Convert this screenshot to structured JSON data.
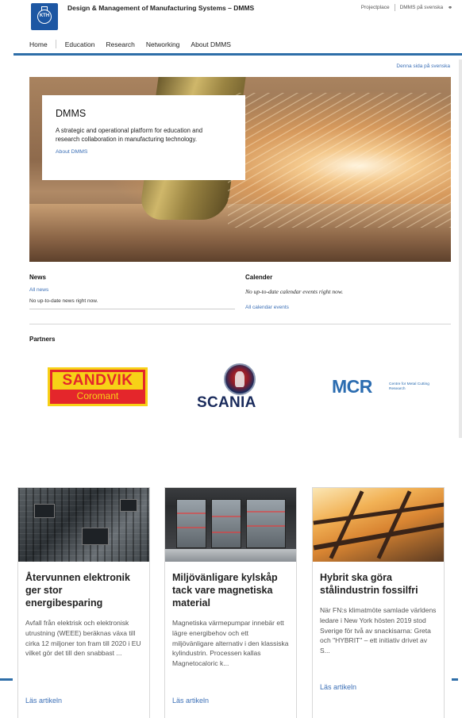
{
  "header": {
    "logo_text": "KTH",
    "site_title": "Design & Management of Manufacturing Systems – DMMS",
    "top_links": [
      "Projectplace",
      "DMMS på svenska"
    ]
  },
  "nav": {
    "items": [
      "Home",
      "Education",
      "Research",
      "Networking",
      "About DMMS"
    ]
  },
  "swedish_link": "Denna sida på svenska",
  "hero": {
    "title": "DMMS",
    "text": "A strategic and operational platform for education and research collaboration in manufacturing technology.",
    "link": "About DMMS"
  },
  "news": {
    "heading": "News",
    "all_link": "All news",
    "empty_text": "No up-to-date news right now."
  },
  "calendar": {
    "heading": "Calender",
    "empty_text": "No up-to-date calendar events right now.",
    "all_link": "All calendar events"
  },
  "partners": {
    "heading": "Partners",
    "sandvik_name": "SANDVIK",
    "sandvik_sub": "Coromant",
    "scania_name": "SCANIA",
    "mcr_name": "MCR",
    "mcr_sub": "Centre for Metal Cutting Research"
  },
  "articles": [
    {
      "title": "Återvunnen elektronik ger stor energibesparing",
      "text": "Avfall från elektrisk och elektronisk utrustning (WEEE) beräknas växa till cirka 12 miljoner ton fram till 2020 i EU vilket gör det till den snabbast ...",
      "link": "Läs artikeln"
    },
    {
      "title": "Miljövänligare kylskåp tack vare magnetiska material",
      "text": "Magnetiska värmepumpar innebär ett lägre energibehov och ett miljövänligare alternativ i den klassiska kylindustrin. Processen kallas Magnetocaloric k...",
      "link": "Läs artikeln"
    },
    {
      "title": "Hybrit ska göra stålindustrin fossilfri",
      "text": "När FN:s klimatmöte samlade världens ledare i New York hösten 2019 stod Sverige för två av snackisarna: Greta och \"HYBRIT\" – ett initiativ drivet av S...",
      "link": "Läs artikeln"
    }
  ],
  "colors": {
    "accent": "#2e6ea8",
    "link": "#3b6fb6"
  }
}
